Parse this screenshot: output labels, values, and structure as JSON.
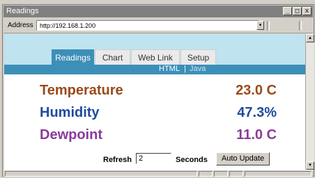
{
  "window": {
    "title": "Readings",
    "controls": [
      "_",
      "□",
      "x"
    ]
  },
  "address": {
    "label": "Address",
    "url": "http://192.168.1.200",
    "dropdown_icon": "▾"
  },
  "tabs": [
    {
      "label": "Readings",
      "active": true
    },
    {
      "label": "Chart",
      "active": false
    },
    {
      "label": "Web Link",
      "active": false
    },
    {
      "label": "Setup",
      "active": false
    }
  ],
  "subnav": {
    "html": "HTML",
    "separator": "|",
    "java": "Java"
  },
  "readings": [
    {
      "label": "Temperature",
      "value": "23.0 C",
      "color": "#9a4a1a"
    },
    {
      "label": "Humidity",
      "value": "47.3%",
      "color": "#1f4aa0"
    },
    {
      "label": "Dewpoint",
      "value": "11.0 C",
      "color": "#8a3a9a"
    }
  ],
  "refresh": {
    "label": "Refresh",
    "value": "2",
    "seconds_label": "Seconds",
    "button": "Auto Update"
  },
  "colors": {
    "accent": "#3d8fb8",
    "header_band": "#bfe3ef"
  }
}
